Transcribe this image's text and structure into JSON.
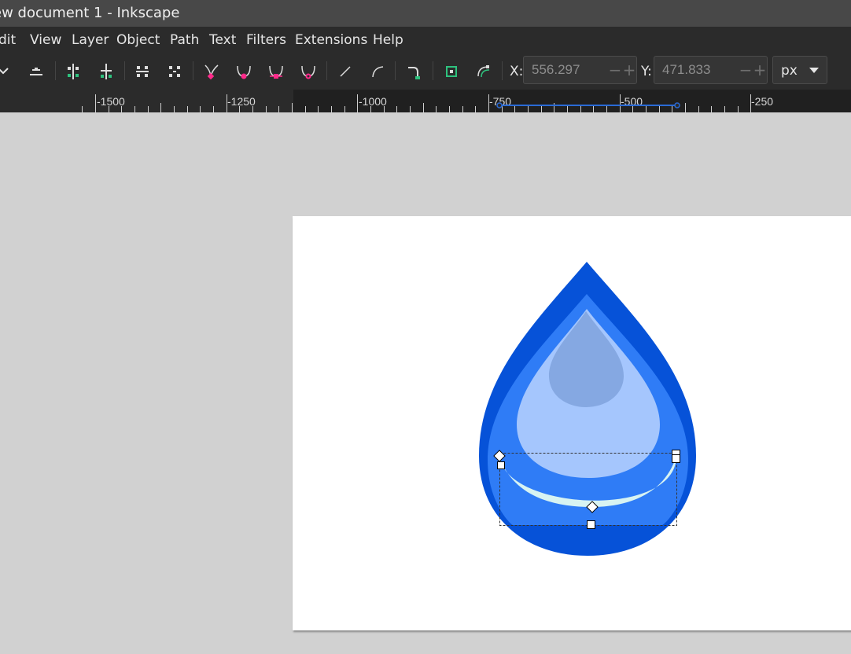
{
  "window": {
    "title": "ew document 1 - Inkscape"
  },
  "menu": [
    "dit",
    "View",
    "Layer",
    "Object",
    "Path",
    "Text",
    "Filters",
    "Extensions",
    "Help"
  ],
  "toolbar": {
    "icons": [
      "chevron-down-icon",
      "delete-node-icon",
      "join-nodes-icon",
      "break-path-icon",
      "join-segment-icon",
      "delete-segment-icon",
      "make-cusp-icon",
      "make-smooth-icon",
      "make-symmetric-icon",
      "make-auto-smooth-icon",
      "segment-line-icon",
      "segment-curve-icon",
      "object-to-path-icon",
      "show-bbox-icon",
      "show-path-outline-icon"
    ],
    "x_label": "X:",
    "x_value": "556.297",
    "y_label": "Y:",
    "y_value": "471.833",
    "unit": "px"
  },
  "ruler": {
    "labels": [
      "-1500",
      "-1250",
      "-1000",
      "-750",
      "-500",
      "-250"
    ]
  },
  "colors": {
    "drop_outer": "#0652d8",
    "drop_middle": "#2f7cf6",
    "drop_inner": "#a5c6fd",
    "drop_highlight": "#85a8e2",
    "crescent": "#d7f3f2",
    "accent_node": "#ff2a8a"
  }
}
